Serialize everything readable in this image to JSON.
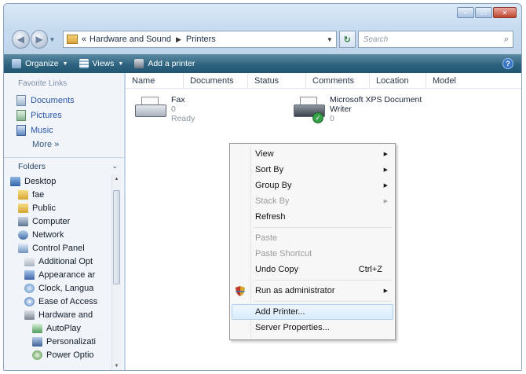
{
  "window": {
    "caption_buttons": [
      "minimize",
      "maximize",
      "close"
    ]
  },
  "address_bar": {
    "prefix": "«",
    "crumbs": [
      "Hardware and Sound",
      "Printers"
    ]
  },
  "search": {
    "placeholder": "Search"
  },
  "toolbar": {
    "organize": "Organize",
    "views": "Views",
    "add_printer": "Add a printer"
  },
  "left_pane": {
    "favorite_links_heading": "Favorite Links",
    "favorites": [
      {
        "label": "Documents",
        "icon": "documents-icon"
      },
      {
        "label": "Pictures",
        "icon": "pictures-icon"
      },
      {
        "label": "Music",
        "icon": "music-icon"
      }
    ],
    "more": "More »",
    "folders_heading": "Folders",
    "tree": [
      {
        "label": "Desktop",
        "icon": "desktop-icon"
      },
      {
        "label": "fae",
        "icon": "user-folder-icon"
      },
      {
        "label": "Public",
        "icon": "public-folder-icon"
      },
      {
        "label": "Computer",
        "icon": "computer-icon"
      },
      {
        "label": "Network",
        "icon": "network-icon"
      },
      {
        "label": "Control Panel",
        "icon": "control-panel-icon"
      },
      {
        "label": "Additional Opt",
        "icon": "options-icon"
      },
      {
        "label": "Appearance ar",
        "icon": "appearance-icon"
      },
      {
        "label": "Clock, Langua",
        "icon": "clock-icon"
      },
      {
        "label": "Ease of Access",
        "icon": "ease-of-access-icon"
      },
      {
        "label": "Hardware and",
        "icon": "hardware-icon"
      },
      {
        "label": "AutoPlay",
        "icon": "autoplay-icon"
      },
      {
        "label": "Personalizati",
        "icon": "personalization-icon"
      },
      {
        "label": "Power Optio",
        "icon": "power-icon"
      }
    ]
  },
  "columns": [
    "Name",
    "Documents",
    "Status",
    "Comments",
    "Location",
    "Model"
  ],
  "printers": [
    {
      "name": "Fax",
      "documents": "0",
      "status": "Ready"
    },
    {
      "name_line1": "Microsoft XPS Document",
      "name_line2": "Writer",
      "documents": "0"
    }
  ],
  "context_menu": {
    "items": [
      {
        "label": "View",
        "submenu": true,
        "disabled": false
      },
      {
        "label": "Sort By",
        "submenu": true,
        "disabled": false
      },
      {
        "label": "Group By",
        "submenu": true,
        "disabled": false
      },
      {
        "label": "Stack By",
        "submenu": true,
        "disabled": true
      },
      {
        "label": "Refresh",
        "submenu": false,
        "disabled": false
      },
      {
        "label": "Paste",
        "submenu": false,
        "disabled": true
      },
      {
        "label": "Paste Shortcut",
        "submenu": false,
        "disabled": true
      },
      {
        "label": "Undo Copy",
        "shortcut": "Ctrl+Z",
        "disabled": false
      },
      {
        "label": "Run as administrator",
        "submenu": true,
        "disabled": false
      },
      {
        "label": "Add Printer...",
        "disabled": false
      },
      {
        "label": "Server Properties...",
        "disabled": false
      }
    ]
  },
  "colors": {
    "toolbar": "#2e6480",
    "link": "#2a56a6",
    "highlight": "#d9ebfb"
  }
}
